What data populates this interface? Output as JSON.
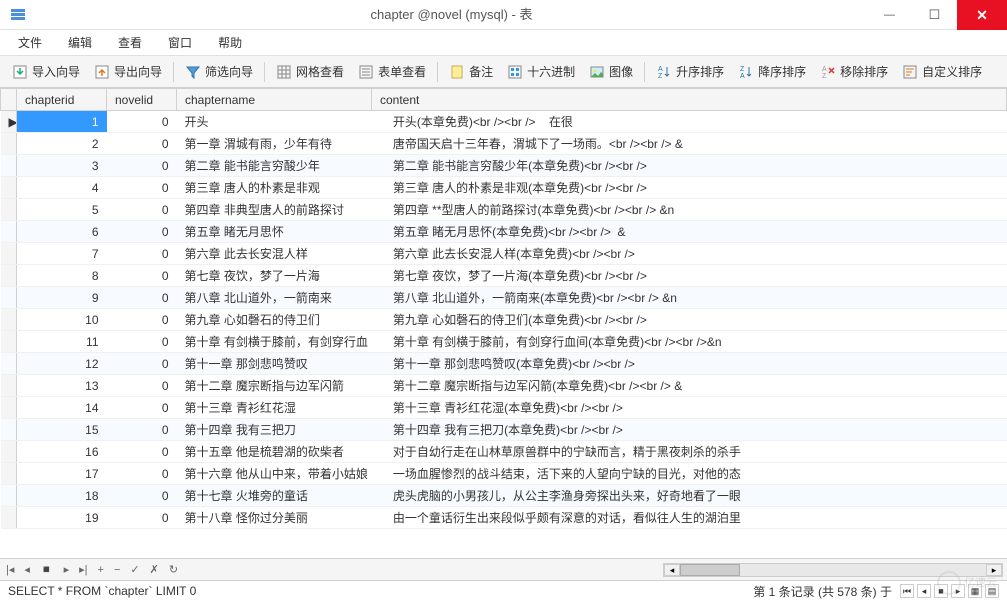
{
  "window": {
    "title": "chapter @novel (mysql) - 表"
  },
  "menu": {
    "file": "文件",
    "edit": "编辑",
    "view": "查看",
    "window": "窗口",
    "help": "帮助"
  },
  "toolbar": {
    "import_wizard": "导入向导",
    "export_wizard": "导出向导",
    "filter_wizard": "筛选向导",
    "grid_view": "网格查看",
    "form_view": "表单查看",
    "memo": "备注",
    "hex": "十六进制",
    "image": "图像",
    "sort_asc": "升序排序",
    "sort_desc": "降序排序",
    "remove_sort": "移除排序",
    "custom_sort": "自定义排序"
  },
  "columns": {
    "chapterid": "chapterid",
    "novelid": "novelid",
    "chaptername": "chaptername",
    "content": "content"
  },
  "rows": [
    {
      "chapterid": "1",
      "novelid": "0",
      "chaptername": "开头",
      "content": "&nbsp;&nbsp;&nbsp;&nbsp;开头(本章免费)<br /><br />&nbsp;&nbsp;&nbsp;&nbsp;在很",
      "selected": true,
      "marker": "▶"
    },
    {
      "chapterid": "2",
      "novelid": "0",
      "chaptername": "第一章 渭城有雨，少年有待",
      "content": "&nbsp;&nbsp;&nbsp;&nbsp;唐帝国天启十三年春，渭城下了一场雨。<br /><br />&nbsp;&"
    },
    {
      "chapterid": "3",
      "novelid": "0",
      "chaptername": "第二章 能书能言穷酸少年",
      "content": "&nbsp;&nbsp;&nbsp;&nbsp;第二章 能书能言穷酸少年(本章免费)<br /><br />&nbsp;&nbsp",
      "alt": true
    },
    {
      "chapterid": "4",
      "novelid": "0",
      "chaptername": "第三章 唐人的朴素是非观",
      "content": "&nbsp;&nbsp;&nbsp;&nbsp;第三章 唐人的朴素是非观(本章免费)<br /><br />&nbsp;&nbsp"
    },
    {
      "chapterid": "5",
      "novelid": "0",
      "chaptername": "第四章 非典型唐人的前路探讨",
      "content": "&nbsp;&nbsp;&nbsp;&nbsp;第四章 **型唐人的前路探讨(本章免费)<br /><br />&nbsp;&n"
    },
    {
      "chapterid": "6",
      "novelid": "0",
      "chaptername": "第五章 睹无月思怀",
      "content": "&nbsp;&nbsp;&nbsp;&nbsp;第五章 睹无月思怀(本章免费)<br /><br />&nbsp;&nbsp;&",
      "alt": true
    },
    {
      "chapterid": "7",
      "novelid": "0",
      "chaptername": "第六章 此去长安混人样",
      "content": "&nbsp;&nbsp;&nbsp;&nbsp;第六章 此去长安混人样(本章免费)<br /><br />&nbsp;&nbsp"
    },
    {
      "chapterid": "8",
      "novelid": "0",
      "chaptername": "第七章 夜饮，梦了一片海",
      "content": "&nbsp;&nbsp;&nbsp;&nbsp;第七章 夜饮，梦了一片海(本章免费)<br /><br />&nbsp;&nbsp"
    },
    {
      "chapterid": "9",
      "novelid": "0",
      "chaptername": "第八章 北山道外，一箭南来",
      "content": "&nbsp;&nbsp;&nbsp;&nbsp;第八章 北山道外，一箭南来(本章免费)<br /><br />&nbsp;&n",
      "alt": true
    },
    {
      "chapterid": "10",
      "novelid": "0",
      "chaptername": "第九章 心如磬石的侍卫们",
      "content": "&nbsp;&nbsp;&nbsp;&nbsp;第九章 心如磬石的侍卫们(本章免费)<br /><br />&nbsp;&nbsp"
    },
    {
      "chapterid": "11",
      "novelid": "0",
      "chaptername": "第十章 有剑横于膝前，有剑穿行血",
      "content": "&nbsp;&nbsp;&nbsp;&nbsp;第十章 有剑横于膝前，有剑穿行血间(本章免费)<br /><br />&n"
    },
    {
      "chapterid": "12",
      "novelid": "0",
      "chaptername": "第十一章 那剑悲鸣赞叹",
      "content": "&nbsp;&nbsp;&nbsp;&nbsp;第十一章 那剑悲鸣赞叹(本章免费)<br /><br />&nbsp;&nbsp",
      "alt": true
    },
    {
      "chapterid": "13",
      "novelid": "0",
      "chaptername": "第十二章 魔宗断指与边军闪箭",
      "content": "&nbsp;&nbsp;&nbsp;&nbsp;第十二章 魔宗断指与边军闪箭(本章免费)<br /><br />&nbsp;&"
    },
    {
      "chapterid": "14",
      "novelid": "0",
      "chaptername": "第十三章 青衫红花湿",
      "content": "&nbsp;&nbsp;&nbsp;&nbsp;第十三章 青衫红花湿(本章免费)<br /><br />&nbsp;&nbsp;"
    },
    {
      "chapterid": "15",
      "novelid": "0",
      "chaptername": "第十四章 我有三把刀",
      "content": "&nbsp;&nbsp;&nbsp;&nbsp;第十四章 我有三把刀(本章免费)<br /><br />&nbsp;&nbsp;",
      "alt": true
    },
    {
      "chapterid": "16",
      "novelid": "0",
      "chaptername": "第十五章 他是梳碧湖的砍柴者",
      "content": "&nbsp;&nbsp;&nbsp;&nbsp;对于自幼行走在山林草原兽群中的宁缺而言，精于黑夜刺杀的杀手"
    },
    {
      "chapterid": "17",
      "novelid": "0",
      "chaptername": "第十六章 他从山中来，带着小姑娘",
      "content": "&nbsp;&nbsp;&nbsp;&nbsp;一场血腥惨烈的战斗结束，活下来的人望向宁缺的目光，对他的态"
    },
    {
      "chapterid": "18",
      "novelid": "0",
      "chaptername": "第十七章 火堆旁的童话",
      "content": "&nbsp;&nbsp;&nbsp;&nbsp;虎头虎脑的小男孩儿，从公主李渔身旁探出头来，好奇地看了一眼",
      "alt": true
    },
    {
      "chapterid": "19",
      "novelid": "0",
      "chaptername": "第十八章 怪你过分美丽",
      "content": "&nbsp;&nbsp;&nbsp;&nbsp;由一个童话衍生出来段似乎颇有深意的对话，看似往人生的湖泊里"
    }
  ],
  "status": {
    "query": "SELECT * FROM `chapter`  LIMIT 0",
    "record_info": "第 1 条记录 (共 578 条) 于"
  },
  "watermark": "亿速云"
}
